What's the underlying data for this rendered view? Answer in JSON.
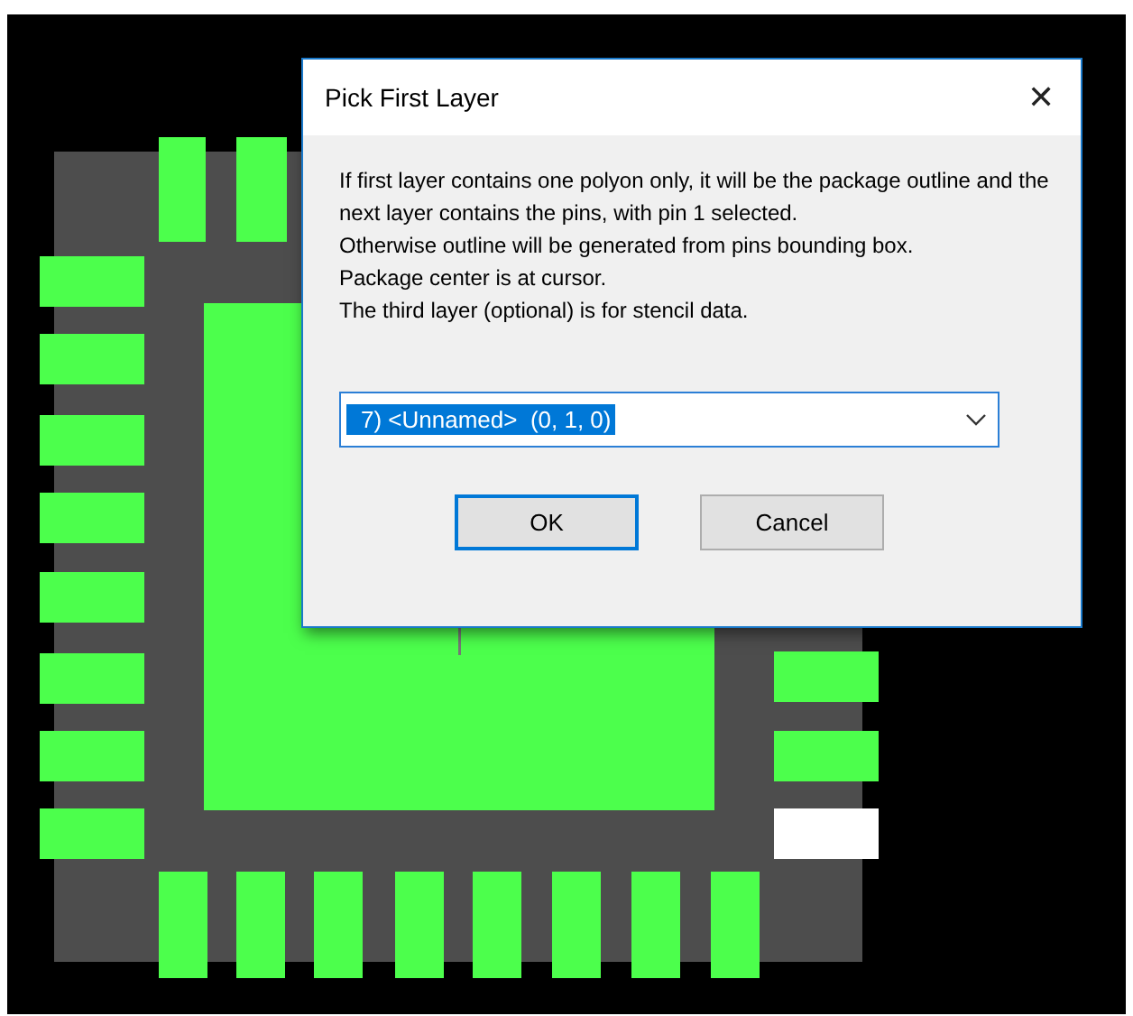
{
  "dialog": {
    "title": "Pick First Layer",
    "close_glyph": "✕",
    "message": [
      "If first layer contains one polyon only, it will be the package outline and the next layer contains the pins, with pin 1 selected.",
      "Otherwise outline will be generated from pins bounding box.",
      "Package center is at cursor.",
      "The third layer (optional) is for stencil data."
    ],
    "layer_select": {
      "value": "7) <Unnamed>  (0, 1, 0)",
      "text_selected": true
    },
    "buttons": [
      {
        "label": "OK",
        "default": true
      },
      {
        "label": "Cancel",
        "default": false
      }
    ]
  }
}
